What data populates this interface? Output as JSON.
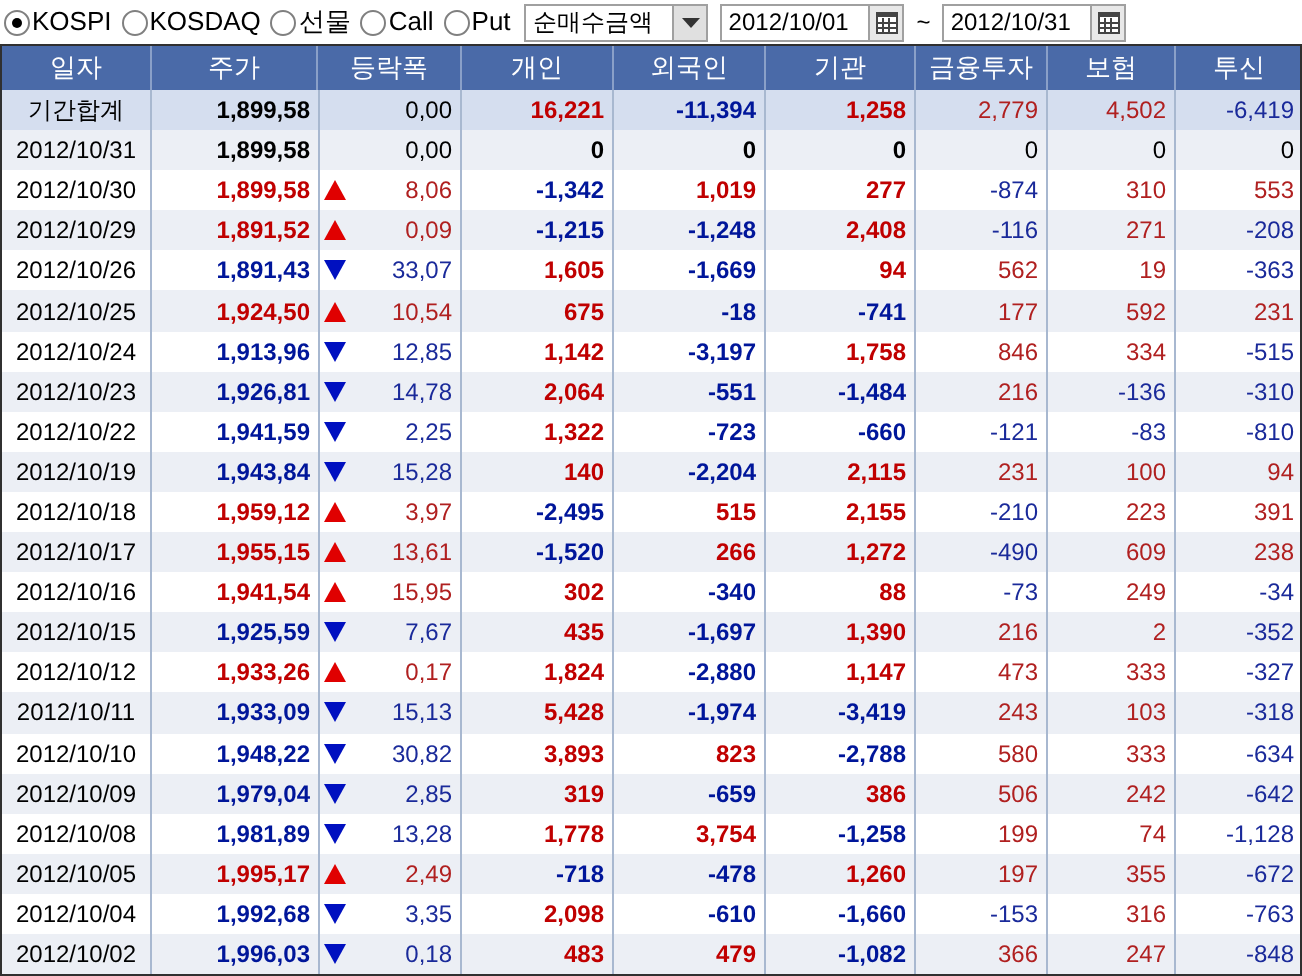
{
  "markets": [
    {
      "label": "KOSPI",
      "selected": true
    },
    {
      "label": "KOSDAQ",
      "selected": false
    },
    {
      "label": "선물",
      "selected": false
    },
    {
      "label": "Call",
      "selected": false
    },
    {
      "label": "Put",
      "selected": false
    }
  ],
  "measure": {
    "value": "순매수금액"
  },
  "date_from": {
    "value": "2012/10/01"
  },
  "range_sep": "~",
  "date_to": {
    "value": "2012/10/31"
  },
  "columns": [
    "일자",
    "주가",
    "등락폭",
    "개인",
    "외국인",
    "기관",
    "금융투자",
    "보험",
    "투신"
  ],
  "rows": [
    {
      "kind": "total",
      "date": "기간합계",
      "price": "1,899,58",
      "up": false,
      "down": false,
      "change": "0,00",
      "investors": [
        {
          "value": "16,221",
          "up": true,
          "down": false
        },
        {
          "value": "-11,394",
          "up": false,
          "down": true
        },
        {
          "value": "1,258",
          "up": true,
          "down": false
        },
        {
          "value": "2,779",
          "up": true,
          "down": false
        },
        {
          "value": "4,502",
          "up": true,
          "down": false
        },
        {
          "value": "-6,419",
          "up": false,
          "down": true
        }
      ]
    },
    {
      "kind": "day",
      "date": "2012/10/31",
      "price": "1,899,58",
      "up": false,
      "down": false,
      "change": "0,00",
      "investors": [
        {
          "value": "0",
          "up": false,
          "down": false
        },
        {
          "value": "0",
          "up": false,
          "down": false
        },
        {
          "value": "0",
          "up": false,
          "down": false
        },
        {
          "value": "0",
          "up": false,
          "down": false
        },
        {
          "value": "0",
          "up": false,
          "down": false
        },
        {
          "value": "0",
          "up": false,
          "down": false
        }
      ]
    },
    {
      "kind": "day",
      "date": "2012/10/30",
      "price": "1,899,58",
      "up": true,
      "down": false,
      "change": "8,06",
      "investors": [
        {
          "value": "-1,342",
          "up": false,
          "down": true
        },
        {
          "value": "1,019",
          "up": true,
          "down": false
        },
        {
          "value": "277",
          "up": true,
          "down": false
        },
        {
          "value": "-874",
          "up": false,
          "down": true
        },
        {
          "value": "310",
          "up": true,
          "down": false
        },
        {
          "value": "553",
          "up": true,
          "down": false
        }
      ]
    },
    {
      "kind": "day",
      "date": "2012/10/29",
      "price": "1,891,52",
      "up": true,
      "down": false,
      "change": "0,09",
      "investors": [
        {
          "value": "-1,215",
          "up": false,
          "down": true
        },
        {
          "value": "-1,248",
          "up": false,
          "down": true
        },
        {
          "value": "2,408",
          "up": true,
          "down": false
        },
        {
          "value": "-116",
          "up": false,
          "down": true
        },
        {
          "value": "271",
          "up": true,
          "down": false
        },
        {
          "value": "-208",
          "up": false,
          "down": true
        }
      ]
    },
    {
      "kind": "day",
      "date": "2012/10/26",
      "price": "1,891,43",
      "up": false,
      "down": true,
      "change": "33,07",
      "investors": [
        {
          "value": "1,605",
          "up": true,
          "down": false
        },
        {
          "value": "-1,669",
          "up": false,
          "down": true
        },
        {
          "value": "94",
          "up": true,
          "down": false
        },
        {
          "value": "562",
          "up": true,
          "down": false
        },
        {
          "value": "19",
          "up": true,
          "down": false
        },
        {
          "value": "-363",
          "up": false,
          "down": true
        }
      ]
    },
    {
      "kind": "day",
      "date": "2012/10/25",
      "price": "1,924,50",
      "up": true,
      "down": false,
      "change": "10,54",
      "investors": [
        {
          "value": "675",
          "up": true,
          "down": false
        },
        {
          "value": "-18",
          "up": false,
          "down": true
        },
        {
          "value": "-741",
          "up": false,
          "down": true
        },
        {
          "value": "177",
          "up": true,
          "down": false
        },
        {
          "value": "592",
          "up": true,
          "down": false
        },
        {
          "value": "231",
          "up": true,
          "down": false
        }
      ]
    },
    {
      "kind": "day",
      "date": "2012/10/24",
      "price": "1,913,96",
      "up": false,
      "down": true,
      "change": "12,85",
      "investors": [
        {
          "value": "1,142",
          "up": true,
          "down": false
        },
        {
          "value": "-3,197",
          "up": false,
          "down": true
        },
        {
          "value": "1,758",
          "up": true,
          "down": false
        },
        {
          "value": "846",
          "up": true,
          "down": false
        },
        {
          "value": "334",
          "up": true,
          "down": false
        },
        {
          "value": "-515",
          "up": false,
          "down": true
        }
      ]
    },
    {
      "kind": "day",
      "date": "2012/10/23",
      "price": "1,926,81",
      "up": false,
      "down": true,
      "change": "14,78",
      "investors": [
        {
          "value": "2,064",
          "up": true,
          "down": false
        },
        {
          "value": "-551",
          "up": false,
          "down": true
        },
        {
          "value": "-1,484",
          "up": false,
          "down": true
        },
        {
          "value": "216",
          "up": true,
          "down": false
        },
        {
          "value": "-136",
          "up": false,
          "down": true
        },
        {
          "value": "-310",
          "up": false,
          "down": true
        }
      ]
    },
    {
      "kind": "day",
      "date": "2012/10/22",
      "price": "1,941,59",
      "up": false,
      "down": true,
      "change": "2,25",
      "investors": [
        {
          "value": "1,322",
          "up": true,
          "down": false
        },
        {
          "value": "-723",
          "up": false,
          "down": true
        },
        {
          "value": "-660",
          "up": false,
          "down": true
        },
        {
          "value": "-121",
          "up": false,
          "down": true
        },
        {
          "value": "-83",
          "up": false,
          "down": true
        },
        {
          "value": "-810",
          "up": false,
          "down": true
        }
      ]
    },
    {
      "kind": "day",
      "date": "2012/10/19",
      "price": "1,943,84",
      "up": false,
      "down": true,
      "change": "15,28",
      "investors": [
        {
          "value": "140",
          "up": true,
          "down": false
        },
        {
          "value": "-2,204",
          "up": false,
          "down": true
        },
        {
          "value": "2,115",
          "up": true,
          "down": false
        },
        {
          "value": "231",
          "up": true,
          "down": false
        },
        {
          "value": "100",
          "up": true,
          "down": false
        },
        {
          "value": "94",
          "up": true,
          "down": false
        }
      ]
    },
    {
      "kind": "day",
      "date": "2012/10/18",
      "price": "1,959,12",
      "up": true,
      "down": false,
      "change": "3,97",
      "investors": [
        {
          "value": "-2,495",
          "up": false,
          "down": true
        },
        {
          "value": "515",
          "up": true,
          "down": false
        },
        {
          "value": "2,155",
          "up": true,
          "down": false
        },
        {
          "value": "-210",
          "up": false,
          "down": true
        },
        {
          "value": "223",
          "up": true,
          "down": false
        },
        {
          "value": "391",
          "up": true,
          "down": false
        }
      ]
    },
    {
      "kind": "day",
      "date": "2012/10/17",
      "price": "1,955,15",
      "up": true,
      "down": false,
      "change": "13,61",
      "investors": [
        {
          "value": "-1,520",
          "up": false,
          "down": true
        },
        {
          "value": "266",
          "up": true,
          "down": false
        },
        {
          "value": "1,272",
          "up": true,
          "down": false
        },
        {
          "value": "-490",
          "up": false,
          "down": true
        },
        {
          "value": "609",
          "up": true,
          "down": false
        },
        {
          "value": "238",
          "up": true,
          "down": false
        }
      ]
    },
    {
      "kind": "day",
      "date": "2012/10/16",
      "price": "1,941,54",
      "up": true,
      "down": false,
      "change": "15,95",
      "investors": [
        {
          "value": "302",
          "up": true,
          "down": false
        },
        {
          "value": "-340",
          "up": false,
          "down": true
        },
        {
          "value": "88",
          "up": true,
          "down": false
        },
        {
          "value": "-73",
          "up": false,
          "down": true
        },
        {
          "value": "249",
          "up": true,
          "down": false
        },
        {
          "value": "-34",
          "up": false,
          "down": true
        }
      ]
    },
    {
      "kind": "day",
      "date": "2012/10/15",
      "price": "1,925,59",
      "up": false,
      "down": true,
      "change": "7,67",
      "investors": [
        {
          "value": "435",
          "up": true,
          "down": false
        },
        {
          "value": "-1,697",
          "up": false,
          "down": true
        },
        {
          "value": "1,390",
          "up": true,
          "down": false
        },
        {
          "value": "216",
          "up": true,
          "down": false
        },
        {
          "value": "2",
          "up": true,
          "down": false
        },
        {
          "value": "-352",
          "up": false,
          "down": true
        }
      ]
    },
    {
      "kind": "day",
      "date": "2012/10/12",
      "price": "1,933,26",
      "up": true,
      "down": false,
      "change": "0,17",
      "investors": [
        {
          "value": "1,824",
          "up": true,
          "down": false
        },
        {
          "value": "-2,880",
          "up": false,
          "down": true
        },
        {
          "value": "1,147",
          "up": true,
          "down": false
        },
        {
          "value": "473",
          "up": true,
          "down": false
        },
        {
          "value": "333",
          "up": true,
          "down": false
        },
        {
          "value": "-327",
          "up": false,
          "down": true
        }
      ]
    },
    {
      "kind": "day",
      "date": "2012/10/11",
      "price": "1,933,09",
      "up": false,
      "down": true,
      "change": "15,13",
      "investors": [
        {
          "value": "5,428",
          "up": true,
          "down": false
        },
        {
          "value": "-1,974",
          "up": false,
          "down": true
        },
        {
          "value": "-3,419",
          "up": false,
          "down": true
        },
        {
          "value": "243",
          "up": true,
          "down": false
        },
        {
          "value": "103",
          "up": true,
          "down": false
        },
        {
          "value": "-318",
          "up": false,
          "down": true
        }
      ]
    },
    {
      "kind": "day",
      "date": "2012/10/10",
      "price": "1,948,22",
      "up": false,
      "down": true,
      "change": "30,82",
      "investors": [
        {
          "value": "3,893",
          "up": true,
          "down": false
        },
        {
          "value": "823",
          "up": true,
          "down": false
        },
        {
          "value": "-2,788",
          "up": false,
          "down": true
        },
        {
          "value": "580",
          "up": true,
          "down": false
        },
        {
          "value": "333",
          "up": true,
          "down": false
        },
        {
          "value": "-634",
          "up": false,
          "down": true
        }
      ]
    },
    {
      "kind": "day",
      "date": "2012/10/09",
      "price": "1,979,04",
      "up": false,
      "down": true,
      "change": "2,85",
      "investors": [
        {
          "value": "319",
          "up": true,
          "down": false
        },
        {
          "value": "-659",
          "up": false,
          "down": true
        },
        {
          "value": "386",
          "up": true,
          "down": false
        },
        {
          "value": "506",
          "up": true,
          "down": false
        },
        {
          "value": "242",
          "up": true,
          "down": false
        },
        {
          "value": "-642",
          "up": false,
          "down": true
        }
      ]
    },
    {
      "kind": "day",
      "date": "2012/10/08",
      "price": "1,981,89",
      "up": false,
      "down": true,
      "change": "13,28",
      "investors": [
        {
          "value": "1,778",
          "up": true,
          "down": false
        },
        {
          "value": "3,754",
          "up": true,
          "down": false
        },
        {
          "value": "-1,258",
          "up": false,
          "down": true
        },
        {
          "value": "199",
          "up": true,
          "down": false
        },
        {
          "value": "74",
          "up": true,
          "down": false
        },
        {
          "value": "-1,128",
          "up": false,
          "down": true
        }
      ]
    },
    {
      "kind": "day",
      "date": "2012/10/05",
      "price": "1,995,17",
      "up": true,
      "down": false,
      "change": "2,49",
      "investors": [
        {
          "value": "-718",
          "up": false,
          "down": true
        },
        {
          "value": "-478",
          "up": false,
          "down": true
        },
        {
          "value": "1,260",
          "up": true,
          "down": false
        },
        {
          "value": "197",
          "up": true,
          "down": false
        },
        {
          "value": "355",
          "up": true,
          "down": false
        },
        {
          "value": "-672",
          "up": false,
          "down": true
        }
      ]
    },
    {
      "kind": "day",
      "date": "2012/10/04",
      "price": "1,992,68",
      "up": false,
      "down": true,
      "change": "3,35",
      "investors": [
        {
          "value": "2,098",
          "up": true,
          "down": false
        },
        {
          "value": "-610",
          "up": false,
          "down": true
        },
        {
          "value": "-1,660",
          "up": false,
          "down": true
        },
        {
          "value": "-153",
          "up": false,
          "down": true
        },
        {
          "value": "316",
          "up": true,
          "down": false
        },
        {
          "value": "-763",
          "up": false,
          "down": true
        }
      ]
    },
    {
      "kind": "day",
      "date": "2012/10/02",
      "price": "1,996,03",
      "up": false,
      "down": true,
      "change": "0,18",
      "investors": [
        {
          "value": "483",
          "up": true,
          "down": false
        },
        {
          "value": "479",
          "up": true,
          "down": false
        },
        {
          "value": "-1,082",
          "up": false,
          "down": true
        },
        {
          "value": "366",
          "up": true,
          "down": false
        },
        {
          "value": "247",
          "up": true,
          "down": false
        },
        {
          "value": "-848",
          "up": false,
          "down": true
        }
      ]
    }
  ]
}
